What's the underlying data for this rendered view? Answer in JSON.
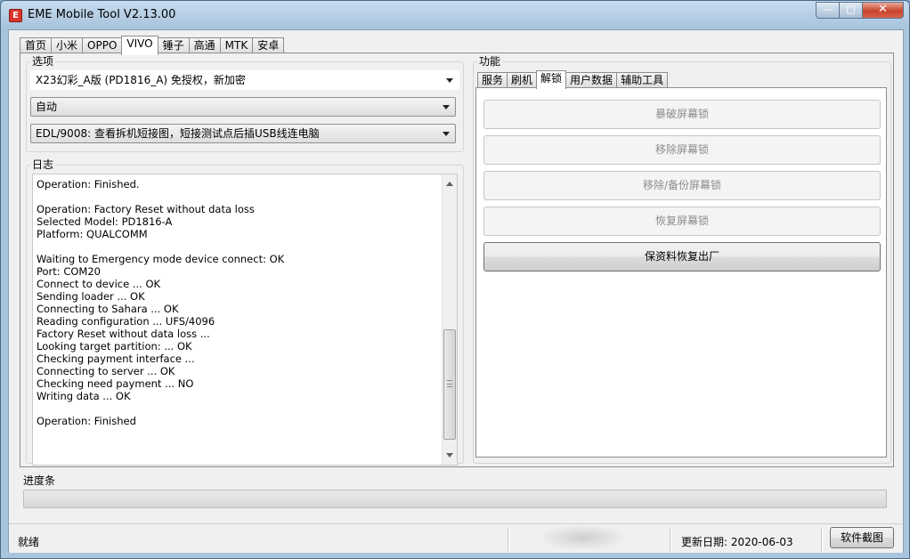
{
  "window": {
    "title": "EME Mobile Tool V2.13.00",
    "app_icon_glyph": "E"
  },
  "top_tabs": [
    {
      "label": "首页",
      "active": false
    },
    {
      "label": "小米",
      "active": false
    },
    {
      "label": "OPPO",
      "active": false
    },
    {
      "label": "VIVO",
      "active": true
    },
    {
      "label": "锤子",
      "active": false
    },
    {
      "label": "高通",
      "active": false
    },
    {
      "label": "MTK",
      "active": false
    },
    {
      "label": "安卓",
      "active": false
    }
  ],
  "options": {
    "legend": "选项",
    "model_select": "X23幻彩_A版 (PD1816_A) 免授权，新加密",
    "mode_select": "自动",
    "port_select": "EDL/9008: 查看拆机短接图，短接测试点后插USB线连电脑"
  },
  "log": {
    "legend": "日志",
    "lines": [
      "Operation: Finished.",
      "",
      "Operation: Factory Reset without data loss",
      "Selected Model: PD1816-A",
      "Platform: QUALCOMM",
      "",
      "Waiting to Emergency mode device connect: OK",
      "Port: COM20",
      "Connect to device ... OK",
      "Sending loader ... OK",
      "Connecting to Sahara ... OK",
      "Reading configuration ... UFS/4096",
      "Factory Reset without data loss ...",
      "Looking target partition: ... OK",
      "Checking payment interface ...",
      "Connecting to server ... OK",
      "Checking need payment ... NO",
      "Writing data ... OK",
      "",
      "Operation: Finished"
    ]
  },
  "functions": {
    "legend": "功能",
    "tabs": [
      {
        "label": "服务",
        "active": false
      },
      {
        "label": "刷机",
        "active": false
      },
      {
        "label": "解锁",
        "active": true
      },
      {
        "label": "用户数据",
        "active": false
      },
      {
        "label": "辅助工具",
        "active": false
      }
    ],
    "buttons": [
      {
        "label": "暴破屏幕锁",
        "enabled": false
      },
      {
        "label": "移除屏幕锁",
        "enabled": false
      },
      {
        "label": "移除/备份屏幕锁",
        "enabled": false
      },
      {
        "label": "恢复屏幕锁",
        "enabled": false
      },
      {
        "label": "保资料恢复出厂",
        "enabled": true
      }
    ]
  },
  "progress": {
    "label": "进度条",
    "value": 0
  },
  "statusbar": {
    "status": "就绪",
    "update_date": "更新日期:  2020-06-03",
    "screenshot_button": "软件截图"
  },
  "colors": {
    "progress_fill": "#3fb34f",
    "close_button": "#c8432c"
  }
}
